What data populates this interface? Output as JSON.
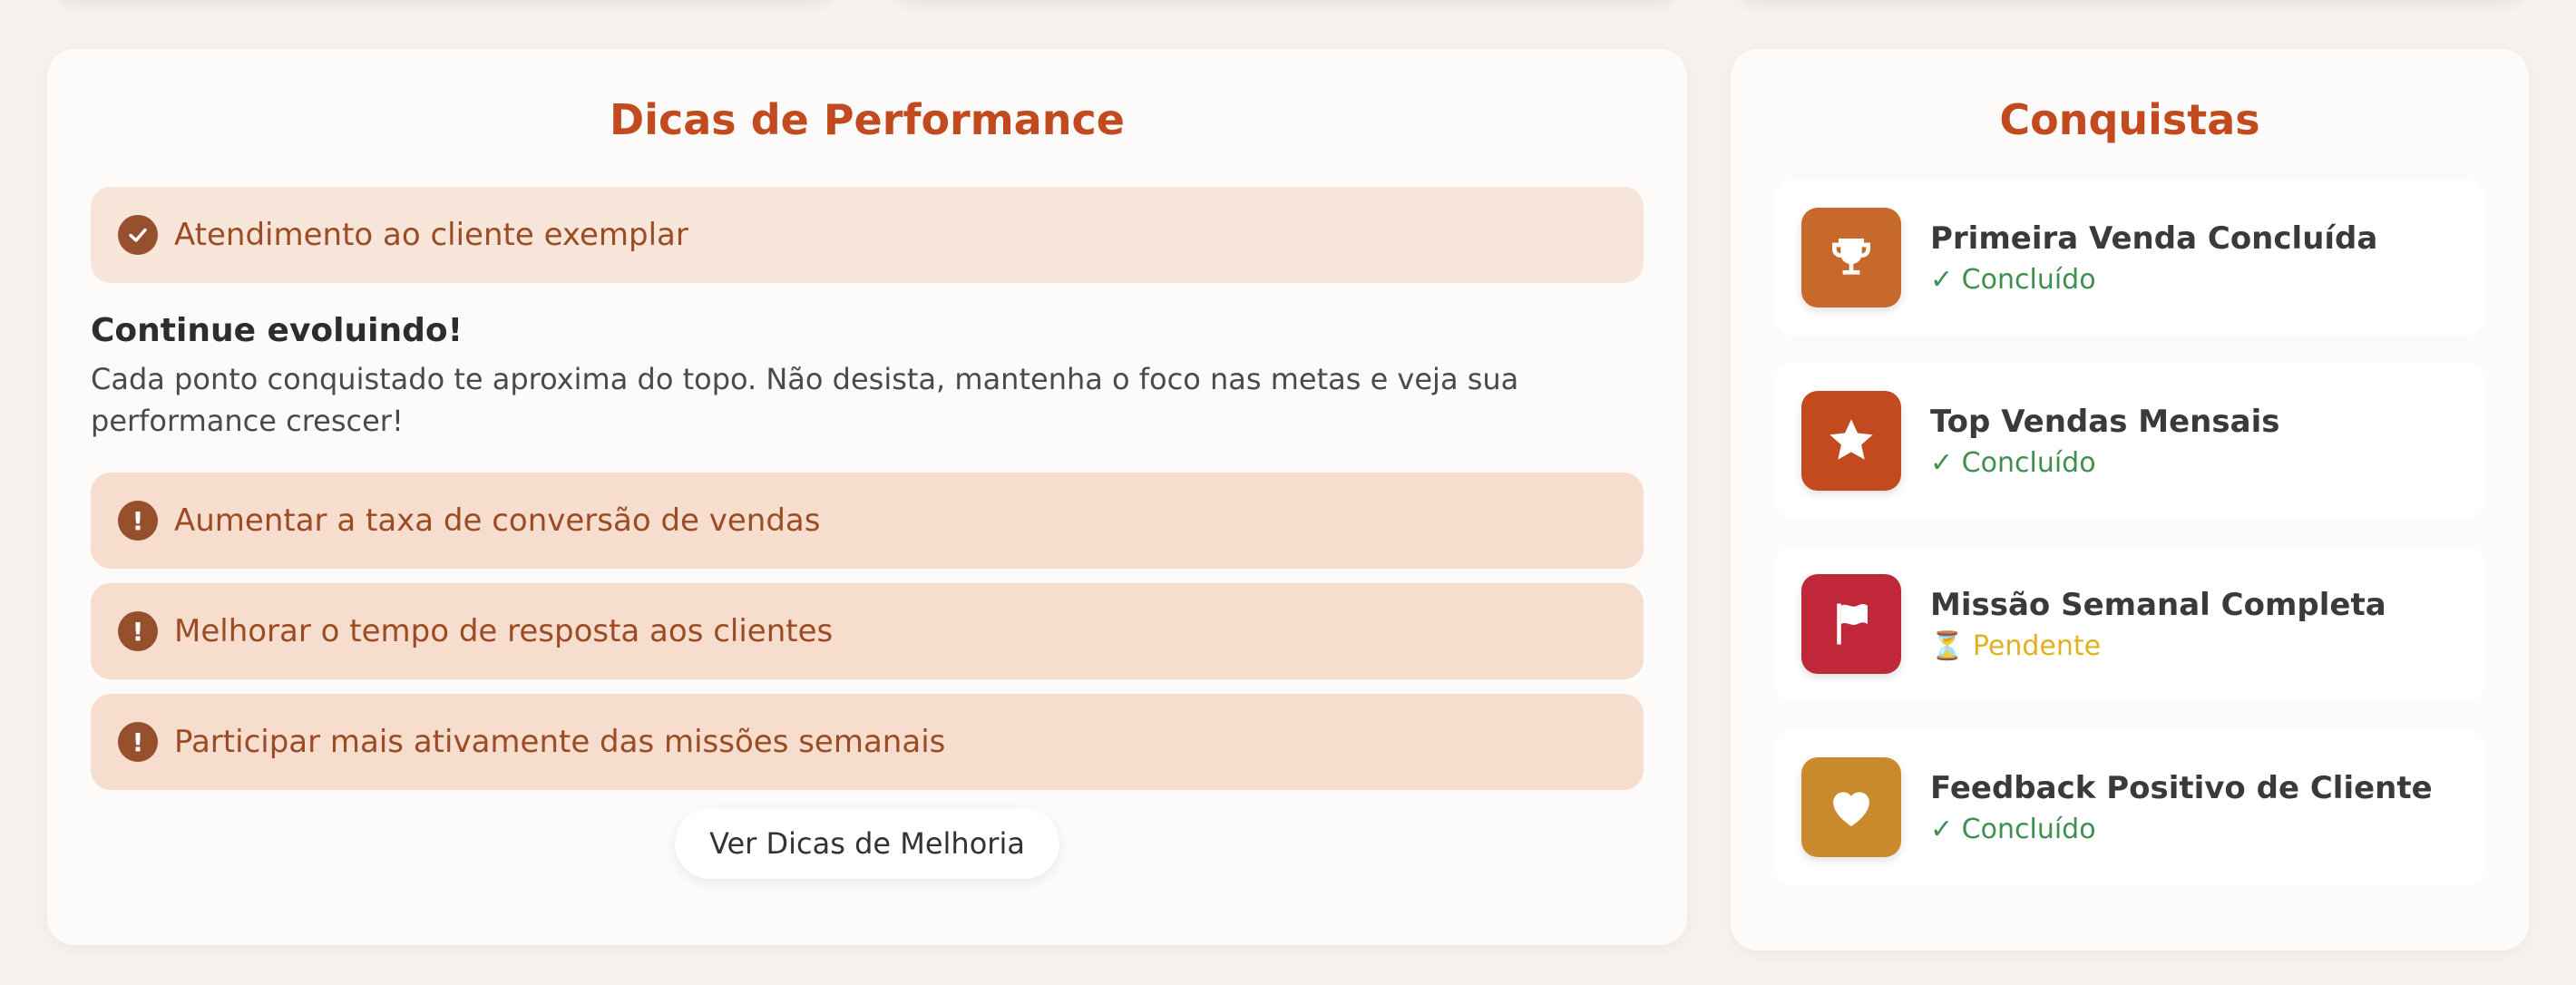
{
  "tips_card": {
    "title": "Dicas de Performance",
    "good_item": "Atendimento ao cliente exemplar",
    "motivation_title": "Continue evoluindo!",
    "motivation_text": "Cada ponto conquistado te aproxima do topo. Não desista, mantenha o foco nas metas e veja sua performance crescer!",
    "improvements": [
      "Aumentar a taxa de conversão de vendas",
      "Melhorar o tempo de resposta aos clientes",
      "Participar mais ativamente das missões semanais"
    ],
    "button_label": "Ver Dicas de Melhoria"
  },
  "achievements": {
    "title": "Conquistas",
    "items": [
      {
        "name": "Primeira Venda Concluída",
        "status": "✓ Concluído",
        "icon": "trophy-icon",
        "color": "#c7692b",
        "status_color": "#3f8f4f"
      },
      {
        "name": "Top Vendas Mensais",
        "status": "✓ Concluído",
        "icon": "star-icon",
        "color": "#c34a1f",
        "status_color": "#3f8f4f"
      },
      {
        "name": "Missão Semanal Completa",
        "status": "⏳ Pendente",
        "icon": "flag-icon",
        "color": "#c0283a",
        "status_color": "#e2b21e"
      },
      {
        "name": "Feedback Positivo de Cliente",
        "status": "✓ Concluído",
        "icon": "heart-icon",
        "color": "#c98a2e",
        "status_color": "#3f8f4f"
      }
    ]
  }
}
